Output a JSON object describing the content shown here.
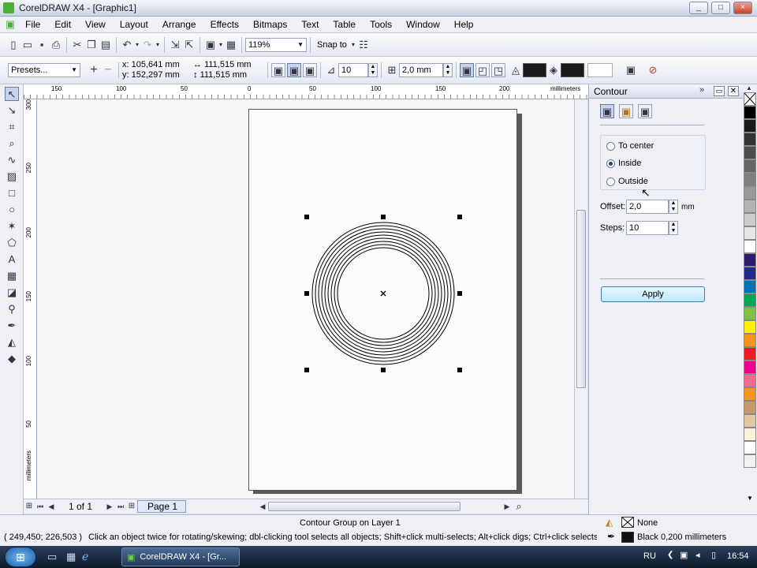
{
  "app": {
    "title": "CorelDRAW X4 - [Graphic1]",
    "window_buttons": [
      "_",
      "□",
      "×"
    ]
  },
  "menu": [
    "File",
    "Edit",
    "View",
    "Layout",
    "Arrange",
    "Effects",
    "Bitmaps",
    "Text",
    "Table",
    "Tools",
    "Window",
    "Help"
  ],
  "toolbar1": {
    "zoom": "119%",
    "snap_to": "Snap to"
  },
  "property_bar": {
    "presets": "Presets...",
    "x": "x: 105,641 mm",
    "y": "y: 152,297 mm",
    "width": "111,515 mm",
    "height": "111,515 mm",
    "steps": "10",
    "offset": "2,0 mm"
  },
  "rulers": {
    "h_labels": [
      "150",
      "100",
      "50",
      "0",
      "50",
      "100",
      "150",
      "200"
    ],
    "h_unit": "millimeters",
    "v_labels": [
      "300",
      "250",
      "200",
      "150",
      "100",
      "50"
    ],
    "v_unit": "millimeters"
  },
  "page_nav": {
    "count": "1 of 1",
    "tab": "Page 1"
  },
  "docker": {
    "title": "Contour",
    "options": [
      "To center",
      "Inside",
      "Outside"
    ],
    "selected": "Inside",
    "offset_label": "Offset:",
    "offset_value": "2,0",
    "offset_unit": "mm",
    "steps_label": "Steps:",
    "steps_value": "10",
    "apply": "Apply"
  },
  "palette_colors": [
    "#ffffff",
    "#000000",
    "#1a1a1a",
    "#333333",
    "#4d4d4d",
    "#666666",
    "#808080",
    "#999999",
    "#b3b3b3",
    "#cccccc",
    "#e6e6e6",
    "#ffffff",
    "#2e1a6e",
    "#1e2a8c",
    "#0072bc",
    "#00a651",
    "#7dc242",
    "#fff200",
    "#f7941d",
    "#ed1c24",
    "#ec008c",
    "#f26a8d",
    "#f7941d",
    "#c49a6c",
    "#e2c79f",
    "#f9f1d8",
    "#ffffff",
    "#f2f2f2"
  ],
  "status": {
    "coords": "( 249,450; 226,503 )",
    "object": "Contour Group on Layer 1",
    "hint": "Click an object twice for rotating/skewing; dbl-clicking tool selects all objects; Shift+click multi-selects; Alt+click digs; Ctrl+click selects in a group",
    "fill": "None",
    "outline": "Black  0,200 millimeters"
  },
  "taskbar": {
    "task": "CorelDRAW X4 - [Gr...",
    "lang": "RU",
    "time": "16:54"
  }
}
